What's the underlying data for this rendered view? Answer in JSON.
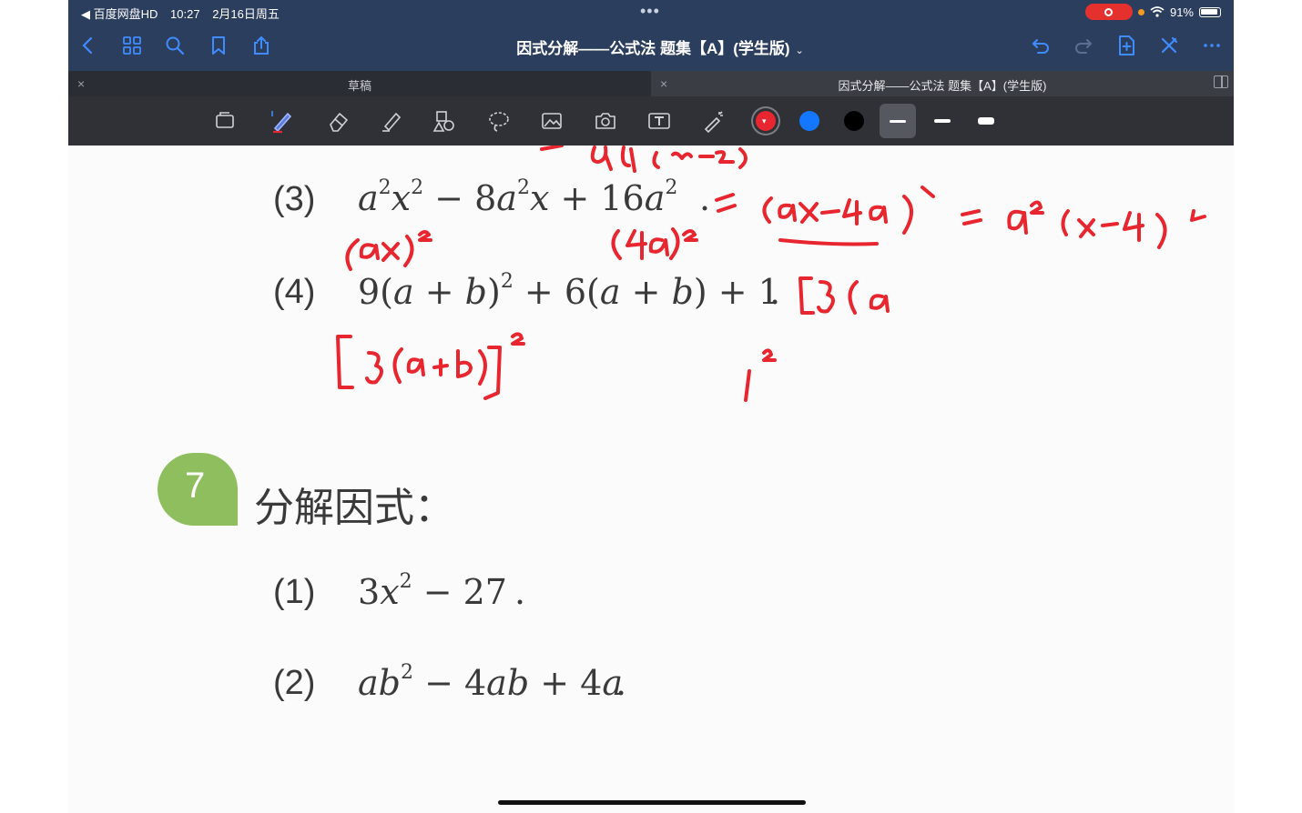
{
  "status_bar": {
    "back_app": "◀ 百度网盘HD",
    "time": "10:27",
    "date": "2月16日周五",
    "dots": "•••",
    "battery": "91%"
  },
  "nav": {
    "title": "因式分解——公式法 题集【A】(学生版)",
    "title_chevron": "⌄"
  },
  "tabs": [
    {
      "label": "草稿",
      "close": "×"
    },
    {
      "label": "因式分解——公式法 题集【A】(学生版)",
      "close": "×"
    }
  ],
  "toolbar": {
    "colors": [
      "#e8262f",
      "#1477ff",
      "#000000"
    ],
    "selected_color": "#e8262f"
  },
  "content": {
    "problems_top": [
      {
        "num": "(3)",
        "expr": "a²x² − 8a²x + 16a²",
        "tail": "."
      },
      {
        "num": "(4)",
        "expr": "9(a + b)² + 6(a + b) + 1",
        "tail": "."
      }
    ],
    "section": {
      "number": "7",
      "title": "分解因式："
    },
    "problems_bottom": [
      {
        "num": "(1)",
        "expr": "3x² − 27",
        "tail": "."
      },
      {
        "num": "(2)",
        "expr": "ab² − 4ab + 4a",
        "tail": "."
      }
    ]
  }
}
